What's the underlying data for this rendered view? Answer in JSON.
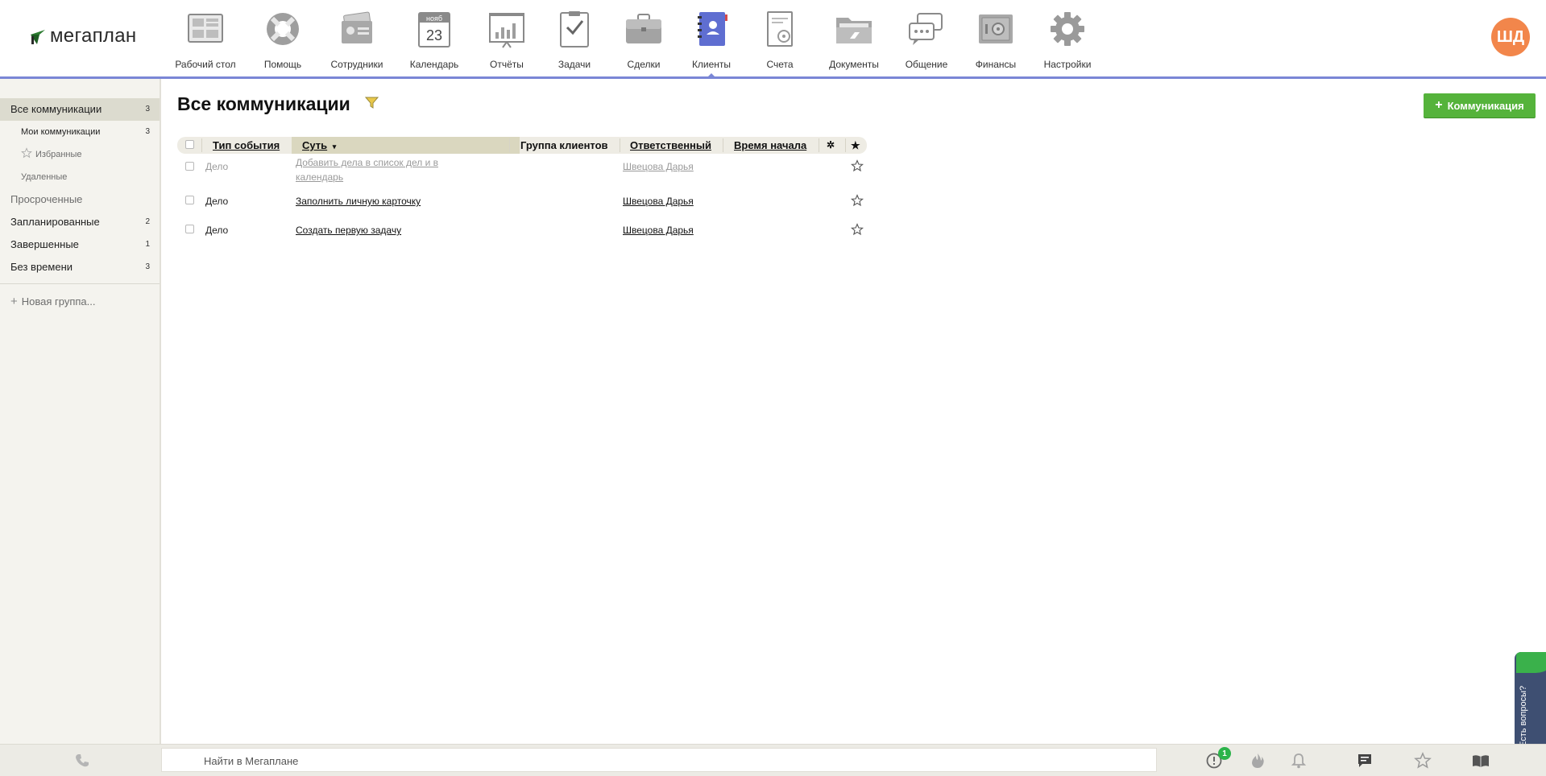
{
  "app": {
    "logo_text": "мегаплан"
  },
  "nav": {
    "items": [
      {
        "label": "Рабочий стол",
        "icon": "desktop-icon"
      },
      {
        "label": "Помощь",
        "icon": "lifebuoy-icon"
      },
      {
        "label": "Сотрудники",
        "icon": "id-cards-icon"
      },
      {
        "label": "Календарь",
        "icon": "calendar-icon",
        "cal_month": "нояб",
        "cal_day": "23"
      },
      {
        "label": "Отчёты",
        "icon": "report-chart-icon"
      },
      {
        "label": "Задачи",
        "icon": "task-clipboard-icon"
      },
      {
        "label": "Сделки",
        "icon": "briefcase-icon"
      },
      {
        "label": "Клиенты",
        "icon": "contacts-book-icon",
        "active": true
      },
      {
        "label": "Счета",
        "icon": "invoice-icon"
      },
      {
        "label": "Документы",
        "icon": "folder-icon"
      },
      {
        "label": "Общение",
        "icon": "chat-bubbles-icon"
      },
      {
        "label": "Финансы",
        "icon": "safe-icon"
      },
      {
        "label": "Настройки",
        "icon": "gear-icon"
      }
    ],
    "active_color": "#7a86d6"
  },
  "user": {
    "initials": "ШД",
    "avatar_color": "#f2864b"
  },
  "sidebar": {
    "items": [
      {
        "label": "Все коммуникации",
        "count": "3"
      },
      {
        "label": "Мои коммуникации",
        "count": "3"
      },
      {
        "label": "Избранные",
        "count": ""
      },
      {
        "label": "Удаленные",
        "count": ""
      },
      {
        "label": "Просроченные",
        "count": ""
      },
      {
        "label": "Запланированные",
        "count": "2"
      },
      {
        "label": "Завершенные",
        "count": "1"
      },
      {
        "label": "Без времени",
        "count": "3"
      }
    ],
    "new_group": "Новая группа..."
  },
  "main": {
    "title": "Все коммуникации",
    "add_button": "Коммуникация",
    "accent_color": "#55b33b"
  },
  "table": {
    "columns": {
      "type": "Тип события",
      "subject": "Суть",
      "client_group": "Группа клиентов",
      "responsible": "Ответственный",
      "start_time": "Время начала"
    },
    "rows": [
      {
        "type": "Дело",
        "subject_line1": "Добавить дела в список дел и в",
        "subject_line2": "календарь",
        "responsible": "Швецова Дарья",
        "muted": true
      },
      {
        "type": "Дело",
        "subject": "Заполнить личную карточку",
        "responsible": "Швецова Дарья",
        "muted": false
      },
      {
        "type": "Дело",
        "subject": "Создать первую задачу",
        "responsible": "Швецова Дарья",
        "muted": false
      }
    ]
  },
  "bottom": {
    "search_placeholder": "Найти в Мегаплане",
    "notification_count": "1"
  },
  "help": {
    "label": "Есть вопросы?"
  }
}
